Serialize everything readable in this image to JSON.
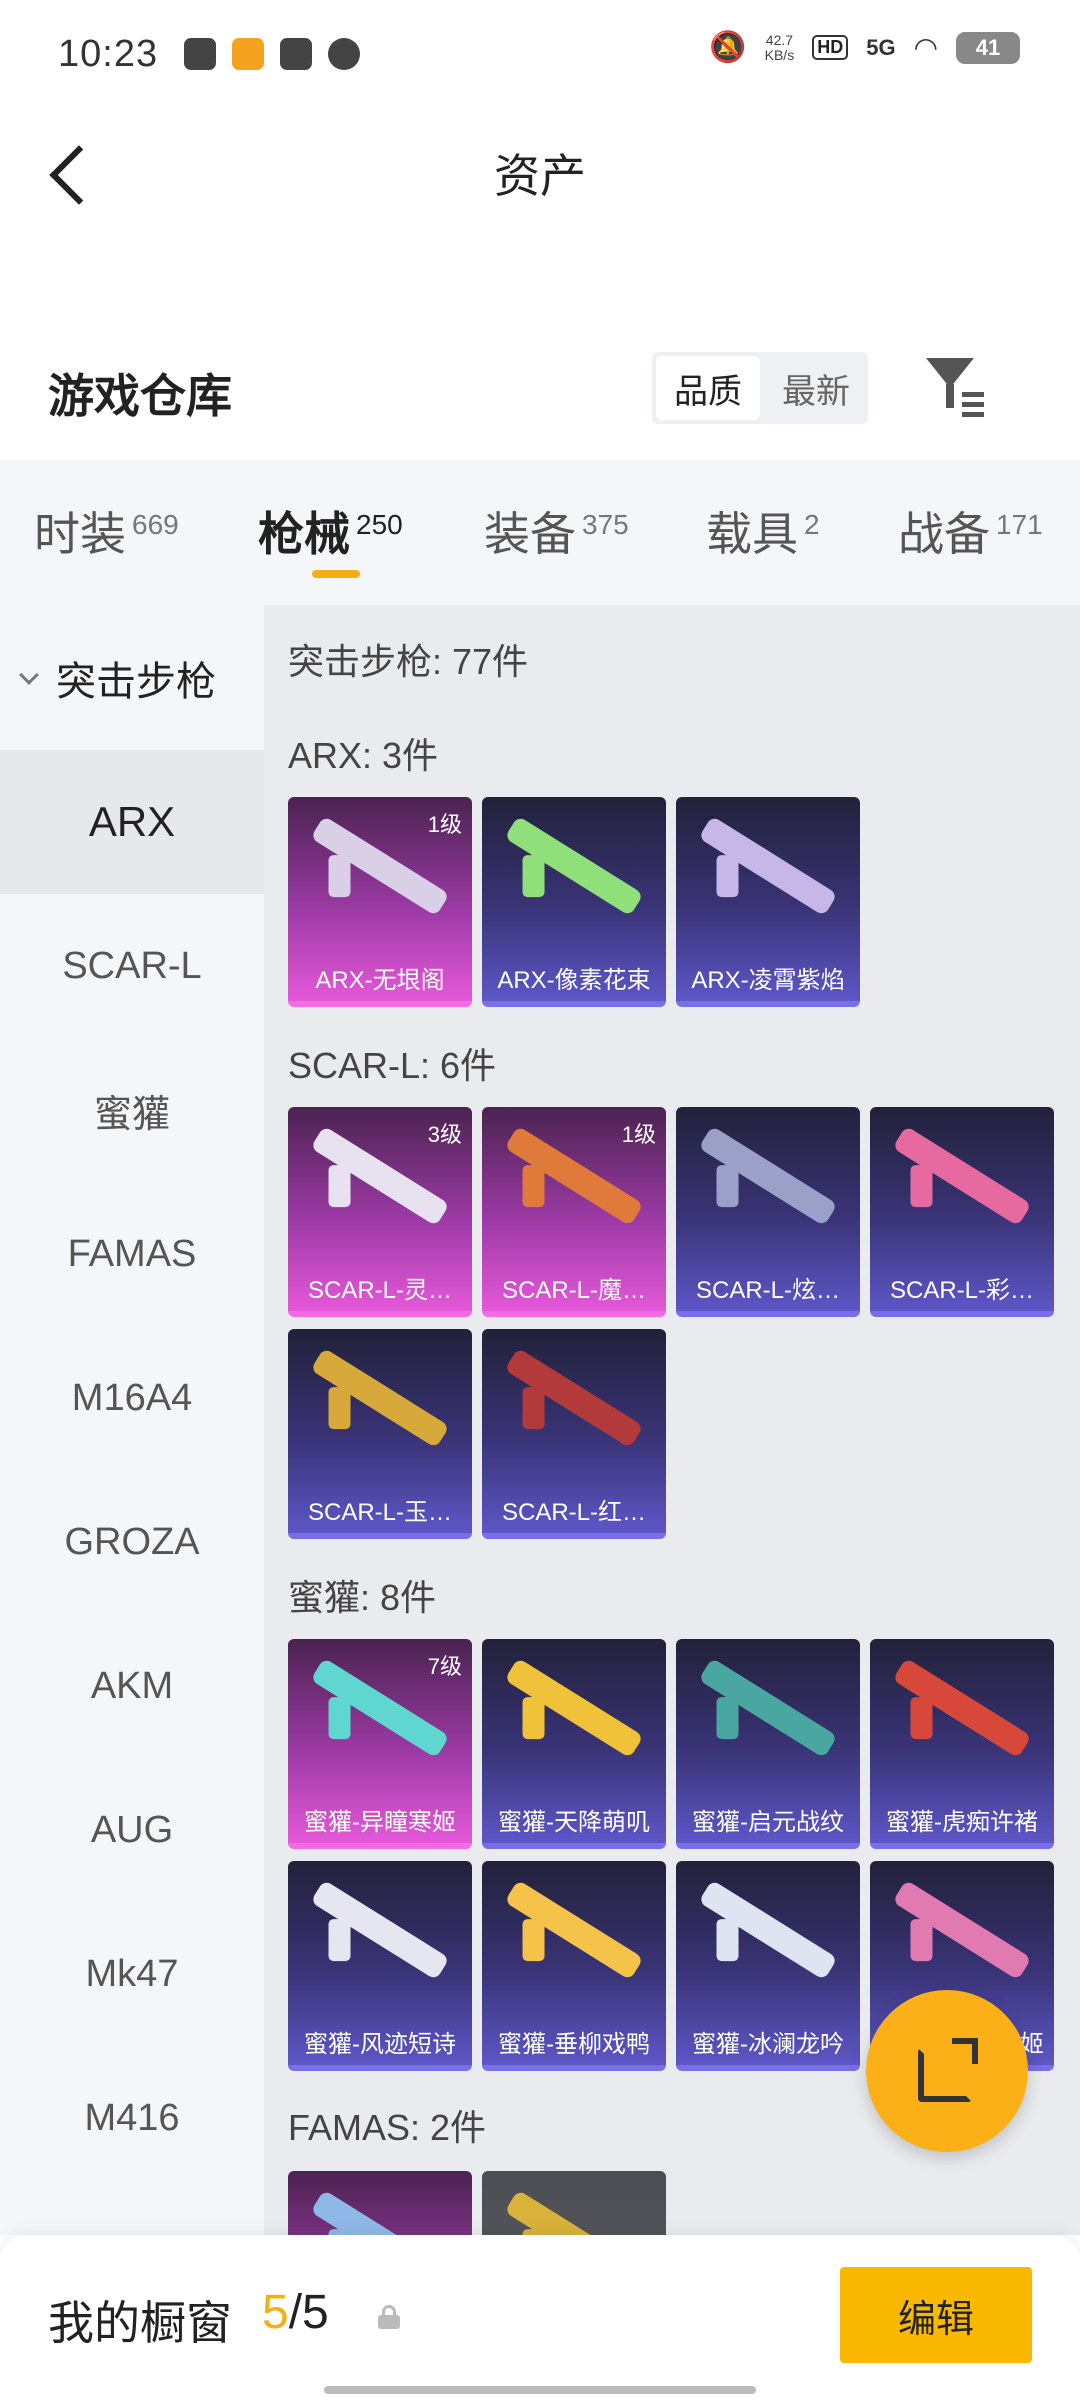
{
  "status_bar": {
    "time": "10:23",
    "net_speed": "42.7",
    "net_unit": "KB/s",
    "hd": "HD",
    "signal": "5G",
    "battery": "41",
    "icons": [
      "mute-icon",
      "wifi-icon",
      "signal-icon",
      "battery-icon"
    ]
  },
  "header": {
    "title": "资产"
  },
  "warehouse": {
    "title": "游戏仓库",
    "sort_quality": "品质",
    "sort_newest": "最新"
  },
  "tabs": [
    {
      "label": "时装",
      "count": "669"
    },
    {
      "label": "枪械",
      "count": "250"
    },
    {
      "label": "装备",
      "count": "375"
    },
    {
      "label": "载具",
      "count": "2"
    },
    {
      "label": "战备",
      "count": "171"
    }
  ],
  "sidebar": {
    "group": "突击步枪",
    "items": [
      "ARX",
      "SCAR-L",
      "蜜獾",
      "FAMAS",
      "M16A4",
      "GROZA",
      "AKM",
      "AUG",
      "Mk47",
      "M416"
    ]
  },
  "content": {
    "total": "突击步枪: 77件",
    "sections": [
      {
        "header": "ARX: 3件",
        "cards": [
          {
            "name": "ARX-无垠阁",
            "level": "1级",
            "rarity": "pink"
          },
          {
            "name": "ARX-像素花束",
            "level": "",
            "rarity": "blue"
          },
          {
            "name": "ARX-凌霄紫焰",
            "level": "",
            "rarity": "blue"
          }
        ]
      },
      {
        "header": "SCAR-L: 6件",
        "cards": [
          {
            "name": "SCAR-L-灵…",
            "level": "3级",
            "rarity": "pink"
          },
          {
            "name": "SCAR-L-魔…",
            "level": "1级",
            "rarity": "pink"
          },
          {
            "name": "SCAR-L-炫…",
            "level": "",
            "rarity": "blue"
          },
          {
            "name": "SCAR-L-彩…",
            "level": "",
            "rarity": "blue"
          },
          {
            "name": "SCAR-L-玉…",
            "level": "",
            "rarity": "blue"
          },
          {
            "name": "SCAR-L-红…",
            "level": "",
            "rarity": "blue"
          }
        ]
      },
      {
        "header": "蜜獾: 8件",
        "cards": [
          {
            "name": "蜜獾-异瞳寒姬",
            "level": "7级",
            "rarity": "pink"
          },
          {
            "name": "蜜獾-天降萌叽",
            "level": "",
            "rarity": "blue"
          },
          {
            "name": "蜜獾-启元战纹",
            "level": "",
            "rarity": "blue"
          },
          {
            "name": "蜜獾-虎痴许褚",
            "level": "",
            "rarity": "blue"
          },
          {
            "name": "蜜獾-风迹短诗",
            "level": "",
            "rarity": "blue"
          },
          {
            "name": "蜜獾-垂柳戏鸭",
            "level": "",
            "rarity": "blue"
          },
          {
            "name": "蜜獾-冰澜龙吟",
            "level": "",
            "rarity": "blue"
          },
          {
            "name": "姬",
            "level": "",
            "rarity": "blue"
          }
        ]
      },
      {
        "header": "FAMAS: 2件",
        "cards": []
      }
    ]
  },
  "showcase": {
    "label": "我的橱窗",
    "used": "5",
    "separator": "/",
    "capacity": "5",
    "edit": "编辑"
  },
  "colors": {
    "accent": "#f5ae15",
    "button": "#fbb800",
    "pink_rarity": "#e458d8",
    "blue_rarity": "#5d56c7"
  }
}
